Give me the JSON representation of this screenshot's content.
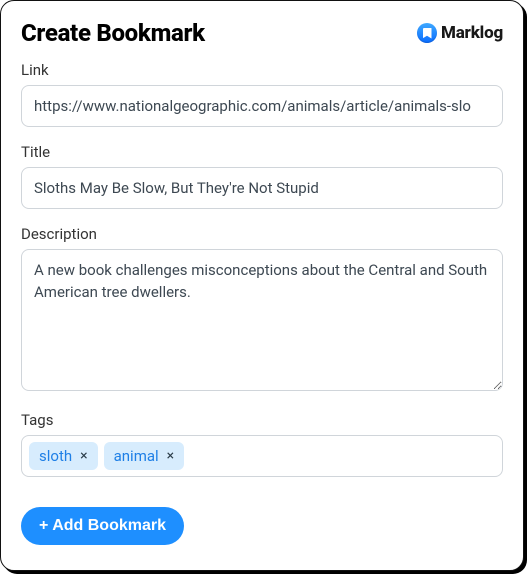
{
  "brand": {
    "name": "Marklog"
  },
  "title": "Create Bookmark",
  "fields": {
    "link": {
      "label": "Link",
      "value": "https://www.nationalgeographic.com/animals/article/animals-slo"
    },
    "title": {
      "label": "Title",
      "value": "Sloths May Be Slow, But They're Not Stupid"
    },
    "description": {
      "label": "Description",
      "value": "A new book challenges misconceptions about the Central and South American tree dwellers."
    },
    "tags": {
      "label": "Tags",
      "items": [
        "sloth",
        "animal"
      ],
      "remove_glyph": "×"
    }
  },
  "submit_label": "+ Add Bookmark"
}
